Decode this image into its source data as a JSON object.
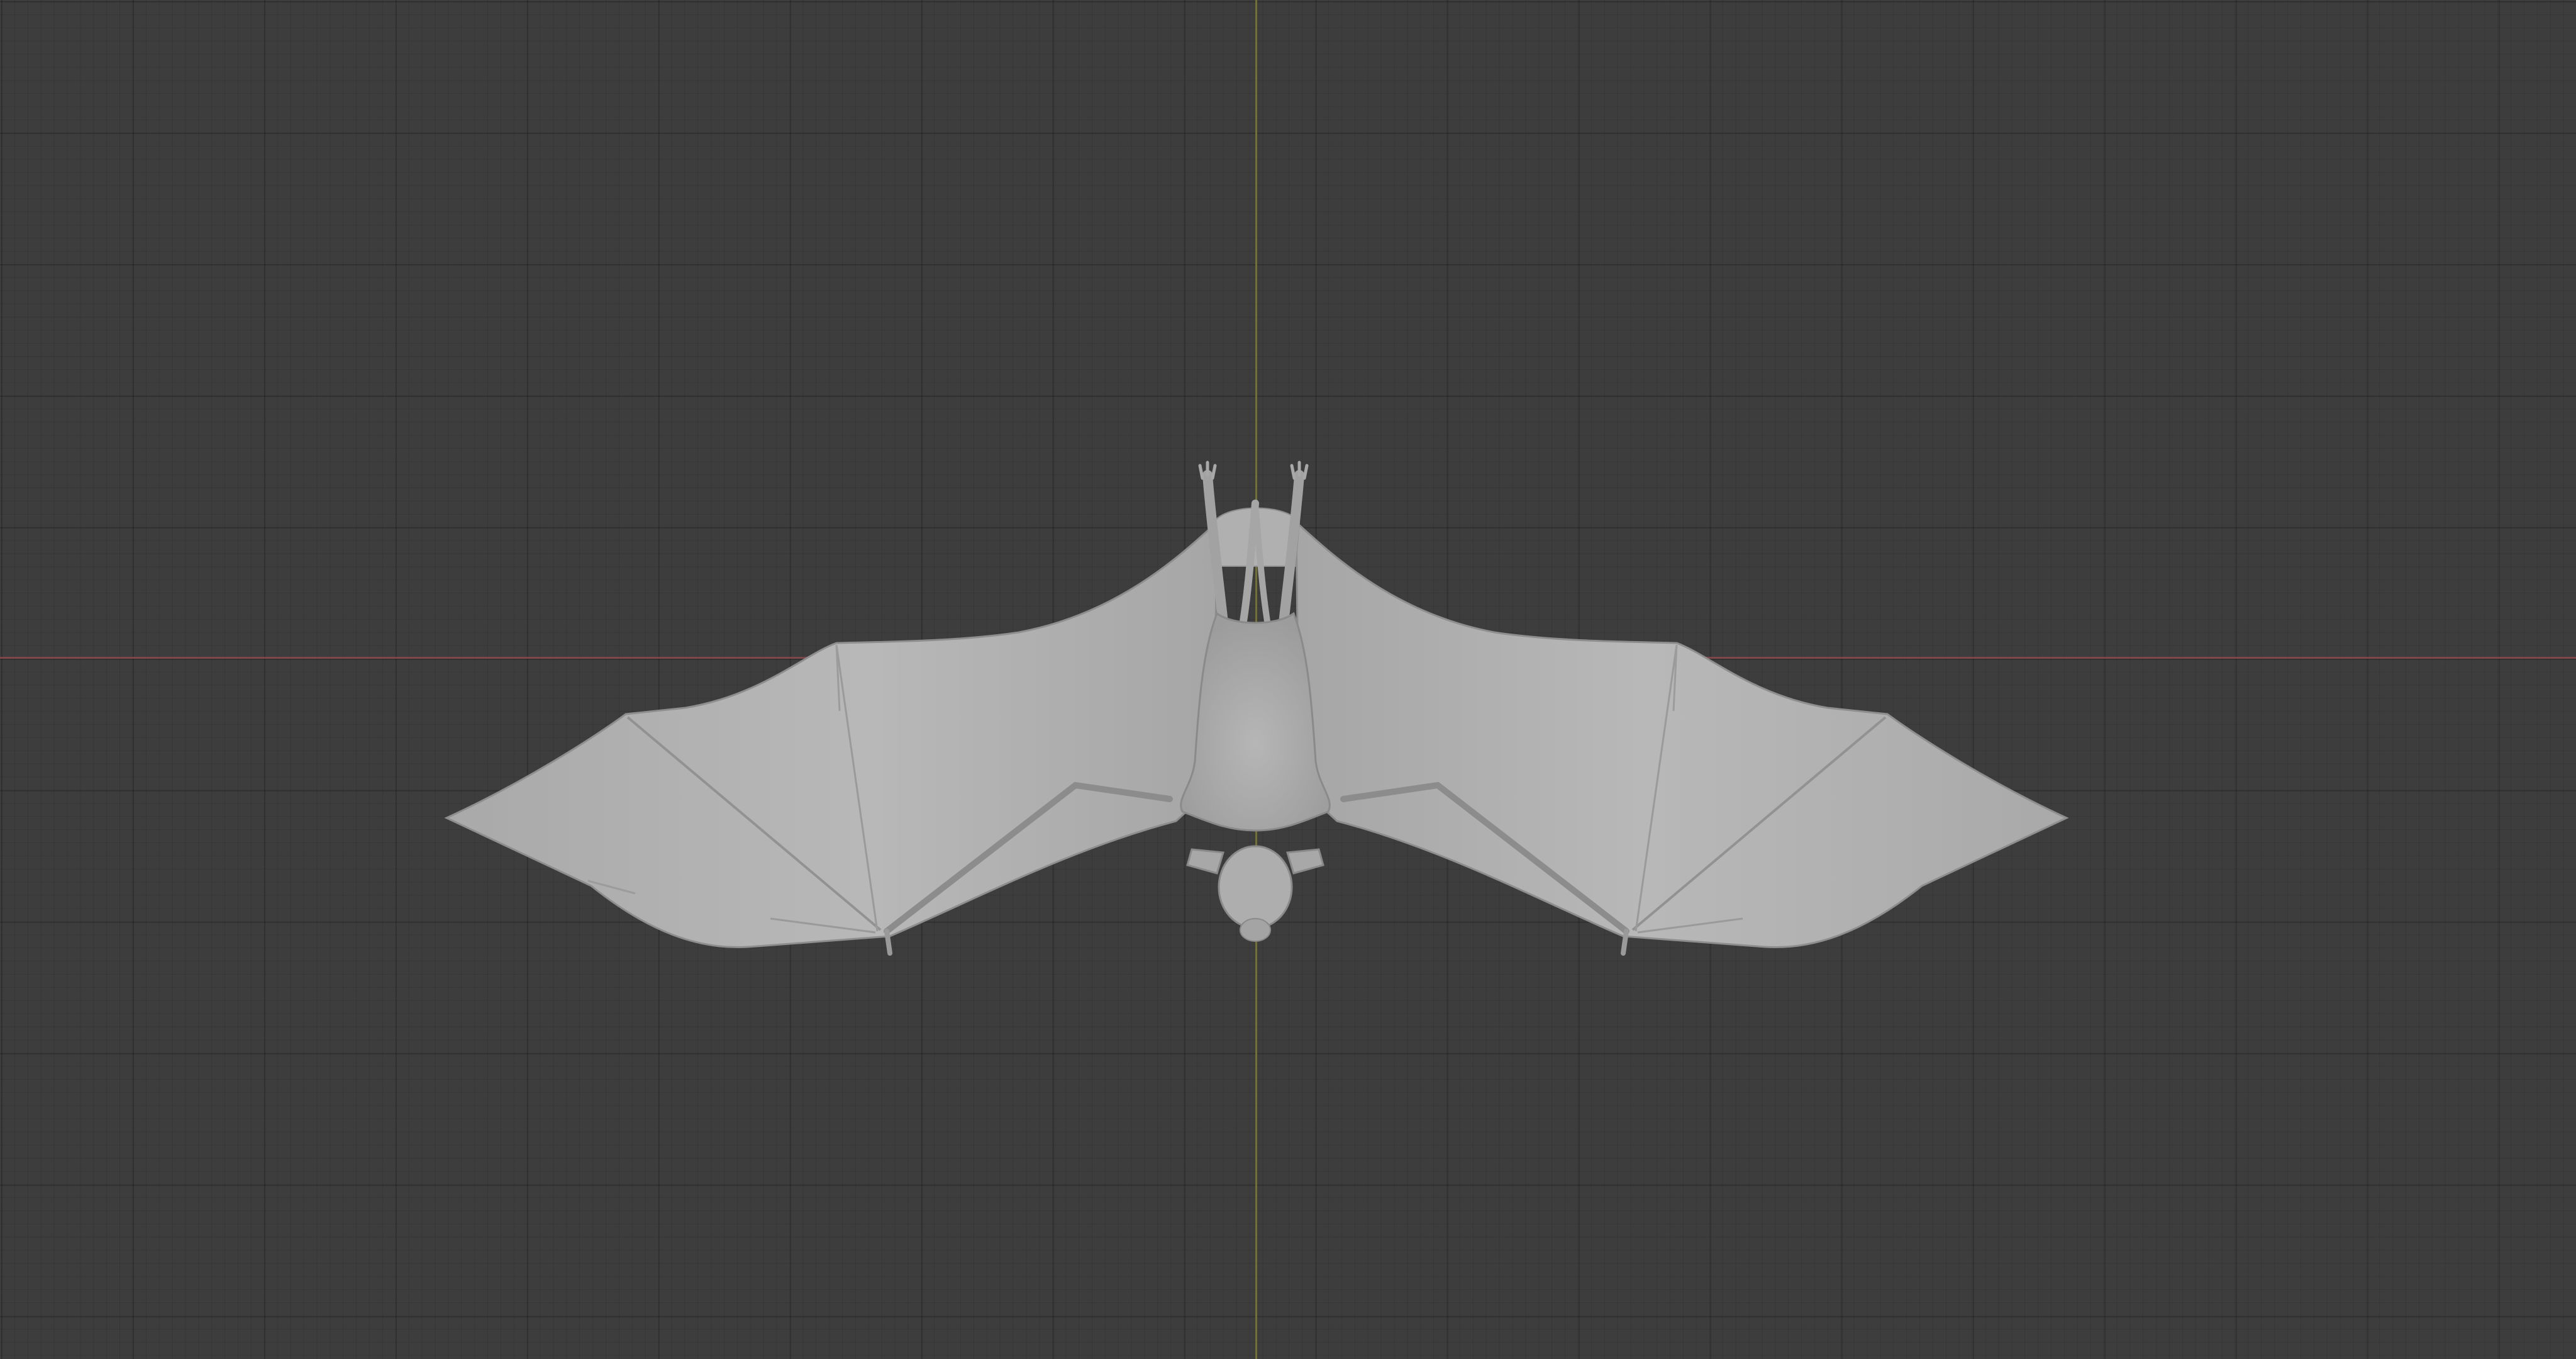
{
  "viewport": {
    "colors": {
      "background": "#3d3d3d",
      "axis_x": "#8a4a4e",
      "axis_y": "#7a7a33",
      "model": "#b4b4b4",
      "model_shade": "#9a9a9a",
      "model_edge": "#7e7e7e"
    },
    "object": {
      "name_hint": "bat-model",
      "shading": "solid"
    }
  }
}
